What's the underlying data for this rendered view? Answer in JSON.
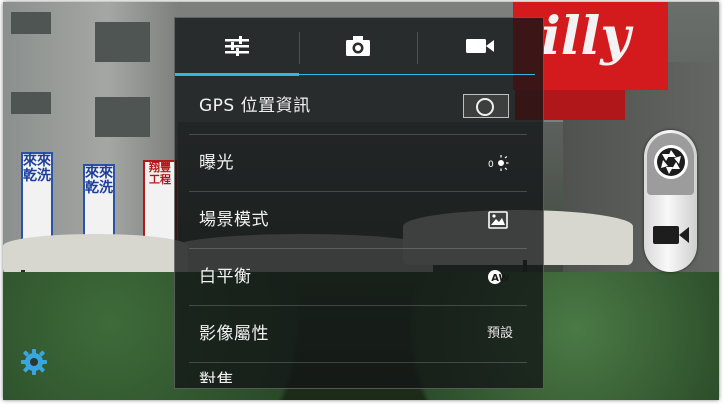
{
  "background": {
    "sign_text": "illy",
    "shop_signs": [
      "來來乾洗",
      "來來乾洗",
      "翔豐 工程"
    ]
  },
  "settings_panel": {
    "tabs": [
      {
        "name": "settings",
        "icon": "sliders-icon"
      },
      {
        "name": "camera",
        "icon": "camera-icon"
      },
      {
        "name": "video",
        "icon": "video-icon"
      }
    ],
    "active_tab": "settings",
    "rows": [
      {
        "label": "GPS 位置資訊",
        "control": "toggle",
        "toggle_on": false
      },
      {
        "label": "曝光",
        "control": "icon",
        "icon": "exposure-icon",
        "icon_value": "0"
      },
      {
        "label": "場景模式",
        "control": "icon",
        "icon": "scene-mode-icon"
      },
      {
        "label": "白平衡",
        "control": "icon",
        "icon": "white-balance-auto-icon",
        "icon_value": "AW"
      },
      {
        "label": "影像屬性",
        "control": "text",
        "value": "預設"
      },
      {
        "label": "對焦",
        "control": "none",
        "partially_hidden": true
      }
    ]
  },
  "mode_switch": {
    "modes": [
      "camera-shutter-icon",
      "video-camera-icon"
    ],
    "selected": "camera"
  },
  "colors": {
    "accent": "#33b5e5",
    "panel_bg": "#141618",
    "text": "#f2f2f2"
  }
}
